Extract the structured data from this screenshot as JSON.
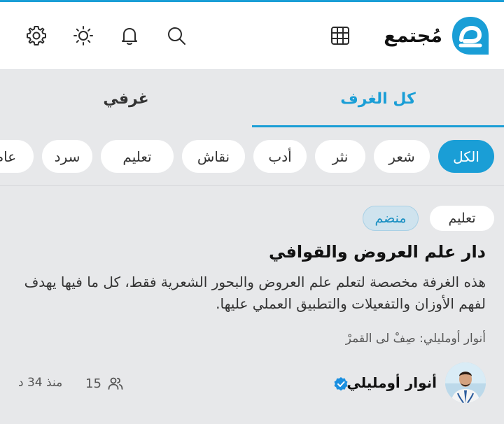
{
  "app": {
    "name": "مُجتمع"
  },
  "colors": {
    "accent": "#1a9ed6",
    "background": "#e7e8ea",
    "header": "#ffffff"
  },
  "header": {
    "icons": [
      "grid-icon",
      "search-icon",
      "bell-icon",
      "sun-icon",
      "gear-icon"
    ]
  },
  "tabs": [
    {
      "label": "كل الغرف",
      "active": true
    },
    {
      "label": "غرفي",
      "active": false
    }
  ],
  "filters": [
    {
      "label": "الكل",
      "selected": true
    },
    {
      "label": "شعر",
      "selected": false
    },
    {
      "label": "نثر",
      "selected": false
    },
    {
      "label": "أدب",
      "selected": false
    },
    {
      "label": "نقاش",
      "selected": false
    },
    {
      "label": "تعليم",
      "selected": false
    },
    {
      "label": "سرد",
      "selected": false
    },
    {
      "label": "عام",
      "selected": false
    }
  ],
  "room": {
    "category": "تعليم",
    "status": "منضم",
    "title": "دار علم العروض والقوافي",
    "description": "هذه الغرفة مخصصة لتعلم علم العروض والبحور الشعرية فقط، كل ما فيها يهدف لفهم الأوزان والتفعيلات والتطبيق العملي عليها.",
    "last_message": "أنوار أومليلي: صِفْ لى القمرْ",
    "author": "أنوار أومليلي",
    "members": "15",
    "time_ago": "منذ 34 د"
  }
}
